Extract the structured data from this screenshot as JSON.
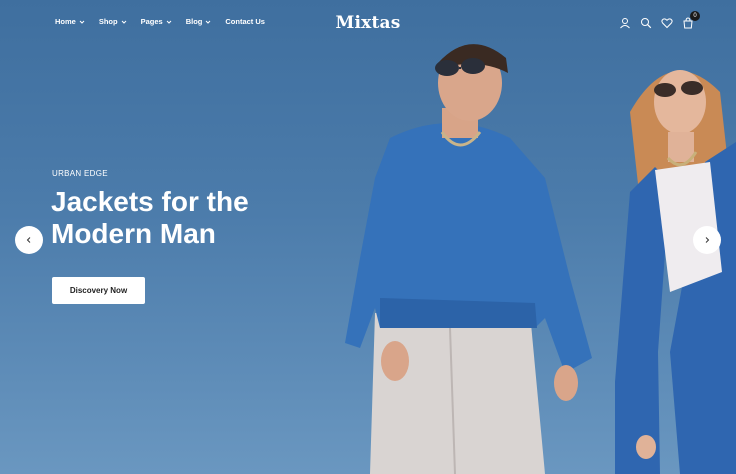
{
  "header": {
    "logo": "Mixtas",
    "nav": [
      {
        "label": "Home",
        "has_dropdown": true
      },
      {
        "label": "Shop",
        "has_dropdown": true
      },
      {
        "label": "Pages",
        "has_dropdown": true
      },
      {
        "label": "Blog",
        "has_dropdown": true
      },
      {
        "label": "Contact Us",
        "has_dropdown": false
      }
    ],
    "icons": [
      "user-icon",
      "search-icon",
      "heart-icon",
      "cart-icon"
    ],
    "cart_count": "0"
  },
  "hero": {
    "eyebrow": "URBAN EDGE",
    "headline_line1": "Jackets for the",
    "headline_line2": "Modern Man",
    "cta_label": "Discovery Now",
    "prev_icon": "chevron-left-icon",
    "next_icon": "chevron-right-icon"
  },
  "colors": {
    "sky": "#4c7cab",
    "garment_blue": "#2f66b0",
    "text": "#ffffff",
    "button_bg": "#ffffff"
  }
}
